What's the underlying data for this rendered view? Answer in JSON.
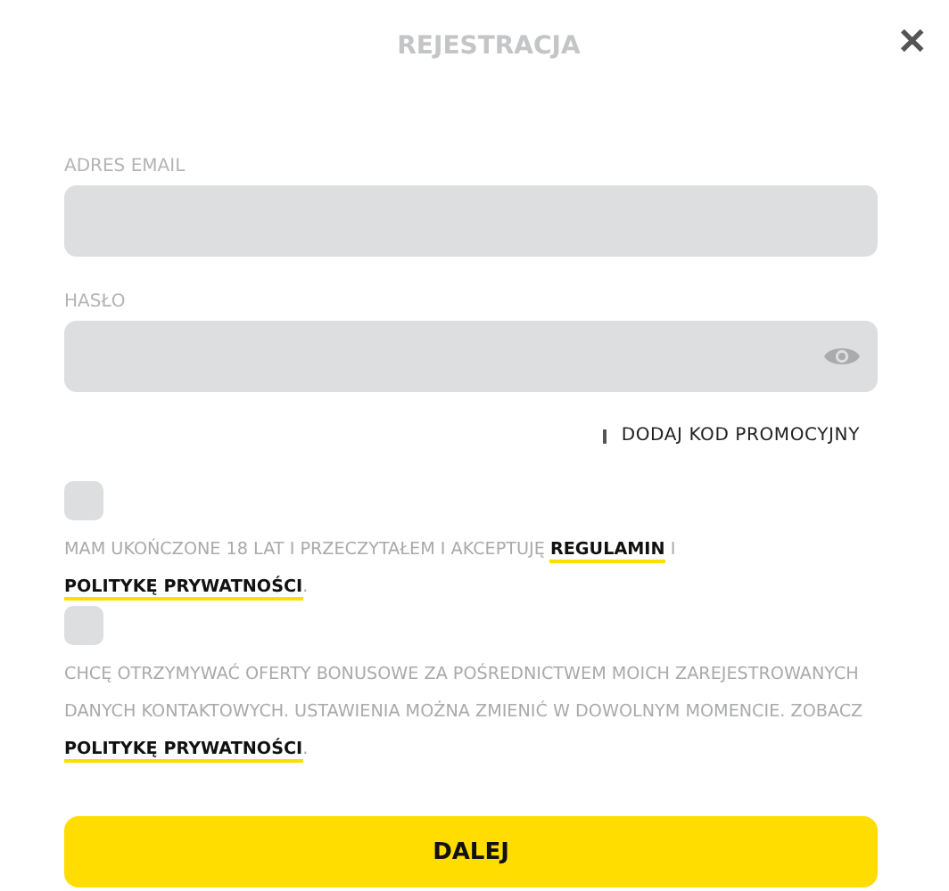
{
  "dialog": {
    "title": "REJESTRACJA",
    "close": "✕"
  },
  "fields": [
    {
      "label": "ADRES EMAIL",
      "kind": "text"
    },
    {
      "label": "HASŁO",
      "kind": "password"
    }
  ],
  "promo_link": "DODAJ KOD PROMOCYJNY",
  "consents": [
    {
      "checked": false,
      "parts": [
        {
          "kind": "text",
          "text": "MAM UKOŃCZONE 18 LAT I PRZECZYTAŁEM I AKCEPTUJĘ "
        },
        {
          "kind": "link",
          "text": "REGULAMIN"
        },
        {
          "kind": "text",
          "text": " I "
        },
        {
          "kind": "link",
          "text": "POLITYKĘ PRYWATNOŚCI"
        },
        {
          "kind": "text",
          "text": "."
        }
      ]
    },
    {
      "checked": false,
      "parts": [
        {
          "kind": "text",
          "text": "CHCĘ OTRZYMYWAĆ OFERTY BONUSOWE ZA POŚREDNICTWEM MOICH ZAREJESTROWANYCH DANYCH KONTAKTOWYCH. USTAWIENIA MOŻNA ZMIENIĆ W DOWOLNYM MOMENCIE. ZOBACZ "
        },
        {
          "kind": "link",
          "text": "POLITYKĘ PRYWATNOŚCI"
        },
        {
          "kind": "text",
          "text": "."
        }
      ]
    }
  ],
  "submit": "DALEJ"
}
